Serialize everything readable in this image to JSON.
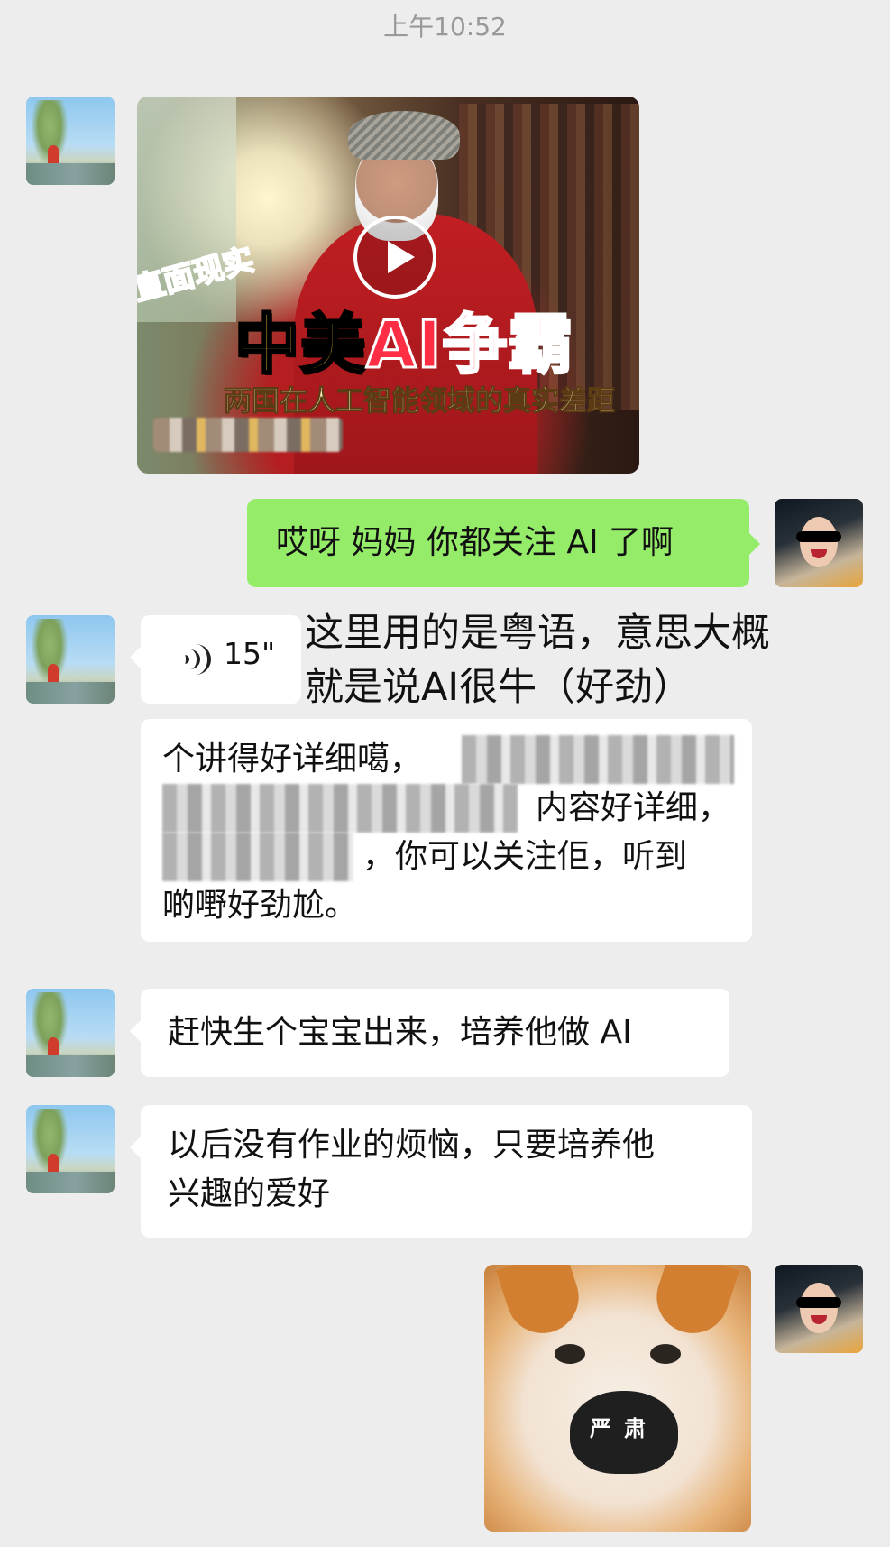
{
  "chat": {
    "timestamp": "上午10:52",
    "video": {
      "headline_small": "直面现实",
      "headline_main_prefix": "中美",
      "headline_main_ai": "AI争霸",
      "headline_sub": "两国在人工智能领域的真实差距"
    },
    "message_me_1": "哎呀 妈妈 你都关注 AI 了啊",
    "voice": {
      "duration": "15\""
    },
    "annotation": "这里用的是粤语，意思大概\n就是说AI很牛（好劲）",
    "transcript": {
      "line1": "个讲得好详细噶，",
      "line2": "内容好详细，",
      "line3": "，你可以关注佢，听到",
      "line4": "啲嘢好劲尬。"
    },
    "message_mom_2": "赶快生个宝宝出来，培养他做 AI",
    "message_mom_3": "以后没有作业的烦恼，只要培养他\n兴趣的爱好",
    "sticker_label": "严肃"
  }
}
